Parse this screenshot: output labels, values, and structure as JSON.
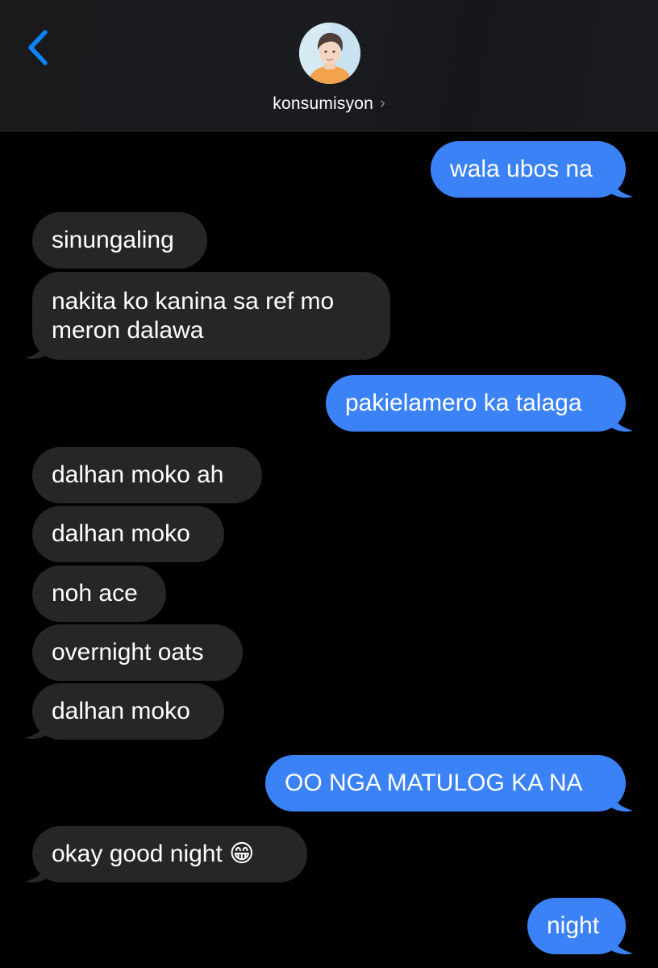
{
  "header": {
    "contact_name": "konsumisyon",
    "back_icon": "chevron-left-icon",
    "contact_chevron": "›",
    "accent_color": "#0a84ff"
  },
  "messages": [
    {
      "from": "me",
      "text": "wala ubos na"
    },
    {
      "from": "them",
      "text": "sinungaling"
    },
    {
      "from": "them",
      "lines": [
        "nakita ko kanina sa ref mo",
        "meron dalawa"
      ]
    },
    {
      "from": "me",
      "text": "pakielamero ka talaga"
    },
    {
      "from": "them",
      "text": "dalhan moko ah"
    },
    {
      "from": "them",
      "text": "dalhan moko"
    },
    {
      "from": "them",
      "text": "noh ace"
    },
    {
      "from": "them",
      "text": "overnight oats"
    },
    {
      "from": "them",
      "text": "dalhan moko"
    },
    {
      "from": "me",
      "text": "OO NGA MATULOG KA NA"
    },
    {
      "from": "them",
      "text": "okay good night 😁"
    },
    {
      "from": "me",
      "text": "night"
    }
  ],
  "colors": {
    "sent_bubble": "#3b82f6",
    "received_bubble": "#262628",
    "background": "#000000"
  }
}
